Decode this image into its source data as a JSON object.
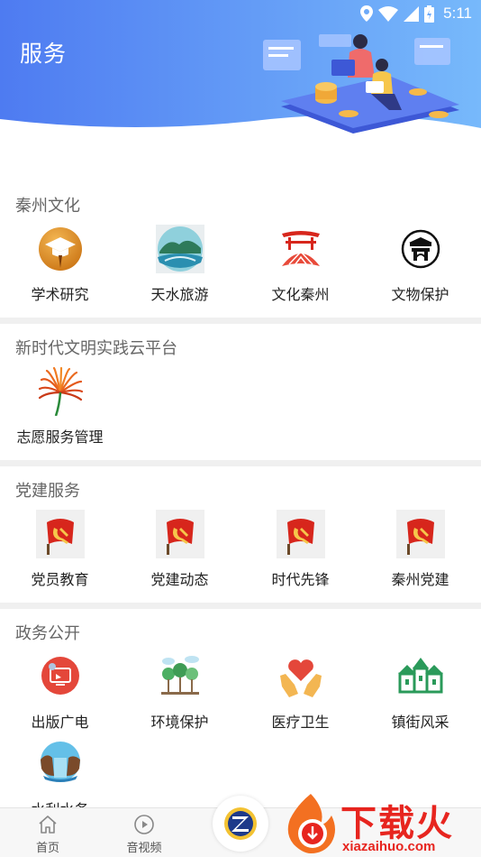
{
  "status_bar": {
    "time": "5:11"
  },
  "header": {
    "title": "服务"
  },
  "sections": {
    "culture": {
      "title": "秦州文化",
      "items": [
        {
          "label": "学术研究",
          "icon": "graduation-cap-icon"
        },
        {
          "label": "天水旅游",
          "icon": "landscape-icon"
        },
        {
          "label": "文化秦州",
          "icon": "pavilion-icon"
        },
        {
          "label": "文物保护",
          "icon": "heritage-gate-icon"
        }
      ]
    },
    "civilization": {
      "title": "新时代文明实践云平台",
      "items": [
        {
          "label": "志愿服务管理",
          "icon": "volunteer-sunburst-icon"
        }
      ]
    },
    "party": {
      "title": "党建服务",
      "items": [
        {
          "label": "党员教育",
          "icon": "party-flag-icon"
        },
        {
          "label": "党建动态",
          "icon": "party-flag-icon"
        },
        {
          "label": "时代先锋",
          "icon": "party-flag-icon"
        },
        {
          "label": "秦州党建",
          "icon": "party-flag-icon"
        }
      ]
    },
    "government": {
      "title": "政务公开",
      "items": [
        {
          "label": "出版广电",
          "icon": "broadcast-icon"
        },
        {
          "label": "环境保护",
          "icon": "trees-icon"
        },
        {
          "label": "医疗卫生",
          "icon": "heart-hands-icon"
        },
        {
          "label": "镇街风采",
          "icon": "town-houses-icon"
        },
        {
          "label": "水利水务",
          "icon": "waterfall-icon"
        }
      ]
    }
  },
  "bottom_nav": {
    "home": "首页",
    "media": "音视频"
  },
  "watermark": {
    "text": "下载火",
    "url": "xiazaihuo.com"
  },
  "colors": {
    "header_gradient_start": "#4f7cf2",
    "header_gradient_end": "#6fb3fb",
    "party_red": "#d7261c",
    "watermark_red": "#e7251f"
  }
}
